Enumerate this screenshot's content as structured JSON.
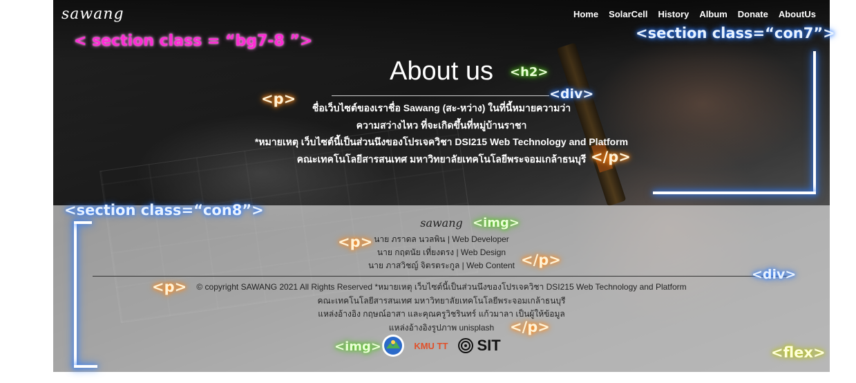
{
  "nav": {
    "brand": "sawang",
    "links": [
      "Home",
      "SolarCell",
      "History",
      "Album",
      "Donate",
      "AboutUs"
    ]
  },
  "about": {
    "title": "About us",
    "lines": [
      "ชื่อเว็บไซต์ของเราชื่อ Sawang (สะ-หว่าง) ในที่นี้หมายความว่า",
      "ความสว่างไหว ที่จะเกิดขึ้นที่หมู่บ้านราชา",
      "*หมายเหตุ เว็บไซต์นี้เป็นส่วนนึงของโปรเจควิชา DSI215 Web Technology and Platform",
      "คณะเทคโนโลยีสารสนเทศ มหาวิทยาลัยเทคโนโลยีพระจอมเกล้าธนบุรี"
    ]
  },
  "credit": {
    "logo": "sawang",
    "team": [
      "นาย ภราดล นวลพิน | Web Developer",
      "นาย กฤตนัย เที่ยงตรง | Web Design",
      "นาย ภาสวิชญ์ จิตรตระกูล | Web Content"
    ],
    "lines": [
      "© copyright SAWANG 2021 All Rights Reserved *หมายเหตุ เว็บไซต์นี้เป็นส่วนนึงของโปรเจควิชา DSI215 Web Technology and Platform",
      "คณะเทคโนโลยีสารสนเทศ มหาวิทยาลัยเทคโนโลยีพระจอมเกล้าธนบุรี",
      "แหล่งอ้างอิง กฤษณ์อาสา และคุณครูวิชรินทร์ แก้วมาลา เป็นผู้ให้ข้อมูล",
      "แหล่งอ้างอิงรูปภาพ unisplash"
    ],
    "logos": {
      "kmutt": "KMU TT",
      "sit": "SIT"
    }
  },
  "annotations": {
    "section_bg": "< section class = “bg7-8 ”>",
    "section_con7": "<section class=“con7”>",
    "h2": "<h2>",
    "div_about": "<div>",
    "p_open_about": "<p>",
    "p_close_about": "</p>",
    "section_con8": "<section class=“con8”>",
    "img_logo": "<img>",
    "p_open_team": "<p>",
    "p_close_team": "</p>",
    "div_credit": "<div>",
    "p_open_credit": "<p>",
    "p_close_credit": "</p>",
    "img_logos": "<img>",
    "flex": "<flex>"
  },
  "colors": {
    "annotation_pink": "#ff2bd6",
    "annotation_blue": "#2f7dff",
    "annotation_orange": "#ff8a1a",
    "annotation_green": "#51c41c",
    "annotation_yellow": "#b8c21c"
  }
}
